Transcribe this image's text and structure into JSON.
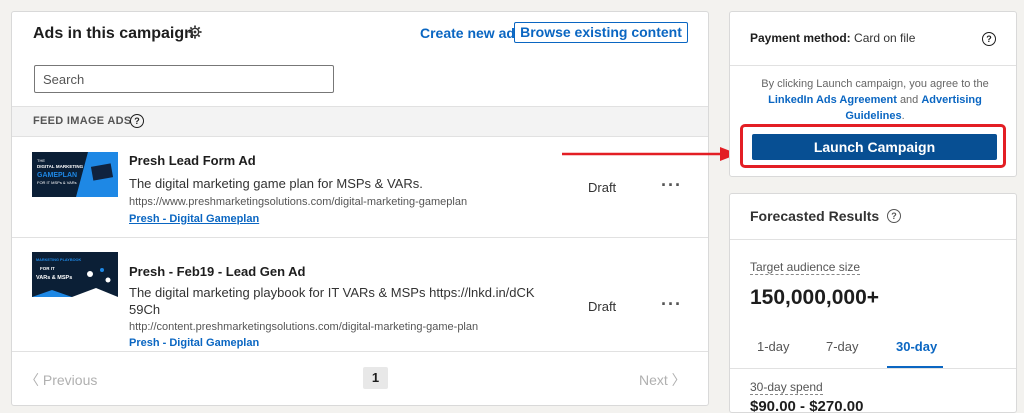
{
  "ads_panel": {
    "title": "Ads in this campaign",
    "create_new_ad": "Create new ad",
    "browse_existing": "Browse existing content",
    "search_placeholder": "Search",
    "section_label": "FEED IMAGE ADS",
    "ads": [
      {
        "name": "Presh Lead Form Ad",
        "description": "The digital marketing game plan for MSPs & VARs.",
        "url": "https://www.preshmarketingsolutions.com/digital-marketing-gameplan",
        "organization": "Presh - Digital Gameplan",
        "status": "Draft",
        "menu": "···",
        "thumb_line1": "THE",
        "thumb_line2": "DIGITAL MARKETING",
        "thumb_line3": "GAMEPLAN",
        "thumb_line4": "FOR IT MSPs & VARs"
      },
      {
        "name": "Presh - Feb19 - Lead Gen Ad",
        "description_line1": "The digital marketing playbook for IT VARs & MSPs https://lnkd.in/dCK",
        "description_line2": "59Ch",
        "url": "http://content.preshmarketingsolutions.com/digital-marketing-game-plan",
        "organization": "Presh - Digital Gameplan",
        "status": "Draft",
        "menu": "···",
        "thumb_line1": "MARKETING PLAYBOOK",
        "thumb_line2": "FOR IT",
        "thumb_line3": "VARs & MSPs"
      }
    ],
    "pagination": {
      "prev": "〈  Previous",
      "current_page": "1",
      "next": "Next  〉"
    }
  },
  "payment_panel": {
    "label": "Payment method:",
    "value": "Card on file",
    "agree_prefix": "By clicking Launch campaign, you agree to the",
    "agreement_link": "LinkedIn Ads Agreement",
    "and": "and",
    "guidelines_link": "Advertising Guidelines",
    "period": ".",
    "launch_button": "Launch Campaign"
  },
  "forecast_panel": {
    "title": "Forecasted Results",
    "target_audience_label": "Target audience size",
    "target_audience_value": "150,000,000+",
    "tabs": [
      "1-day",
      "7-day",
      "30-day"
    ],
    "active_tab": "30-day",
    "spend_label": "30-day spend",
    "spend_value": "$90.00 - $270.00"
  },
  "colors": {
    "accent": "#0a66c2",
    "launch_button": "#074f93",
    "highlight": "#e31e24"
  }
}
